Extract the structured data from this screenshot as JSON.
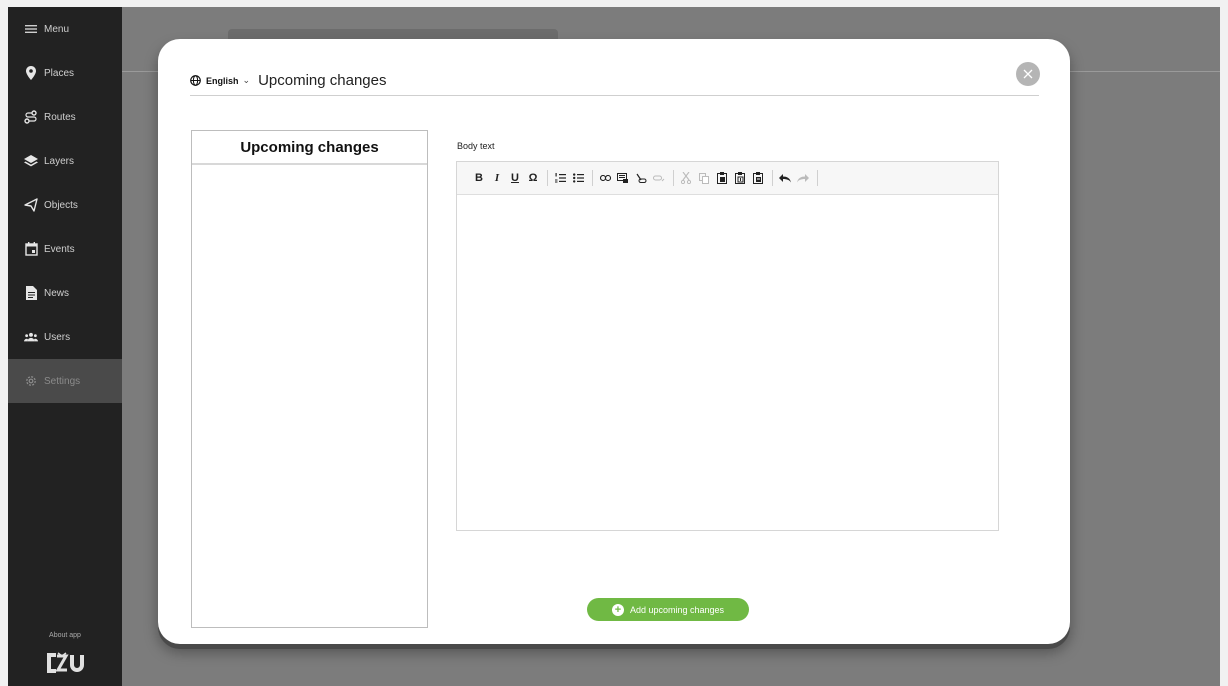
{
  "sidebar": {
    "items": [
      {
        "label": "Menu",
        "icon": "menu-icon"
      },
      {
        "label": "Places",
        "icon": "map-pin-icon"
      },
      {
        "label": "Routes",
        "icon": "route-icon"
      },
      {
        "label": "Layers",
        "icon": "layers-icon"
      },
      {
        "label": "Objects",
        "icon": "objects-icon"
      },
      {
        "label": "Events",
        "icon": "calendar-icon"
      },
      {
        "label": "News",
        "icon": "document-icon"
      },
      {
        "label": "Users",
        "icon": "users-icon"
      },
      {
        "label": "Settings",
        "icon": "gear-icon"
      }
    ],
    "active": "Settings",
    "about_label": "About app",
    "logo_text": "ČZU"
  },
  "modal": {
    "language": "English",
    "title": "Upcoming changes",
    "list_heading": "Upcoming changes",
    "field_label": "Body text",
    "add_button": "Add upcoming changes",
    "toolbar": [
      "bold",
      "italic",
      "underline",
      "special-char",
      "ordered-list",
      "bullet-list",
      "link",
      "image",
      "unlink",
      "anchor",
      "cut",
      "copy",
      "paste",
      "paste-text",
      "paste-word",
      "undo",
      "redo"
    ]
  },
  "colors": {
    "sidebar_bg": "#222222",
    "accent_green": "#70b944",
    "overlay": "#7c7c7c"
  }
}
